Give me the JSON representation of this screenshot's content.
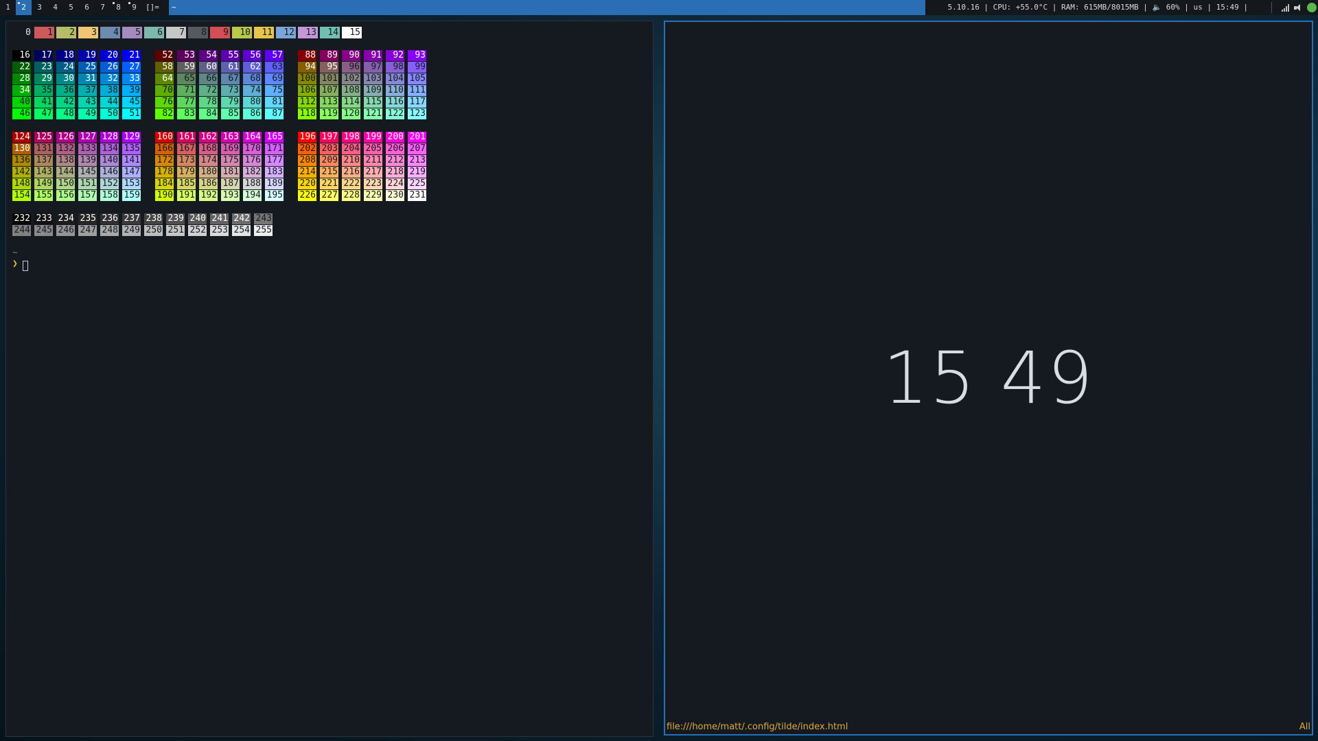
{
  "topbar": {
    "workspaces": [
      "1",
      "2",
      "3",
      "4",
      "5",
      "6",
      "7",
      "8",
      "9"
    ],
    "active_workspace": "2",
    "occupied": [
      "2",
      "8",
      "9"
    ],
    "layout": "[]=",
    "title": "~",
    "status": "5.10.16 | CPU: +55.0°C | RAM: 615MB/8015MB | 🔈 60% | us | 15:49 |",
    "tray_icons": [
      "signal-icon",
      "volume-icon",
      "network-icon"
    ]
  },
  "terminal": {
    "system_colors": [
      {
        "n": "0",
        "bg": "#141a20",
        "fg": "#e6e6e6"
      },
      {
        "n": "1",
        "bg": "#cc5a5a",
        "fg": "#141a20"
      },
      {
        "n": "2",
        "bg": "#b6bd68",
        "fg": "#141a20"
      },
      {
        "n": "3",
        "bg": "#f0c674",
        "fg": "#141a20"
      },
      {
        "n": "4",
        "bg": "#6c8bb0",
        "fg": "#141a20"
      },
      {
        "n": "5",
        "bg": "#a58cbf",
        "fg": "#141a20"
      },
      {
        "n": "6",
        "bg": "#7eb8ac",
        "fg": "#141a20"
      },
      {
        "n": "7",
        "bg": "#c5c8c6",
        "fg": "#141a20"
      },
      {
        "n": "8",
        "bg": "#555a60",
        "fg": "#141a20"
      },
      {
        "n": "9",
        "bg": "#d54e53",
        "fg": "#141a20"
      },
      {
        "n": "10",
        "bg": "#b9ca4a",
        "fg": "#141a20"
      },
      {
        "n": "11",
        "bg": "#e7c547",
        "fg": "#141a20"
      },
      {
        "n": "12",
        "bg": "#7aa6da",
        "fg": "#141a20"
      },
      {
        "n": "13",
        "bg": "#c397d8",
        "fg": "#141a20"
      },
      {
        "n": "14",
        "bg": "#70c0b1",
        "fg": "#141a20"
      },
      {
        "n": "15",
        "bg": "#ffffff",
        "fg": "#141a20"
      }
    ],
    "prompt_dir": "~",
    "prompt_symbol": "❯"
  },
  "browser": {
    "clock": "15 49",
    "status_url": "file:///home/matt/.config/tilde/index.html",
    "status_position": "All"
  }
}
